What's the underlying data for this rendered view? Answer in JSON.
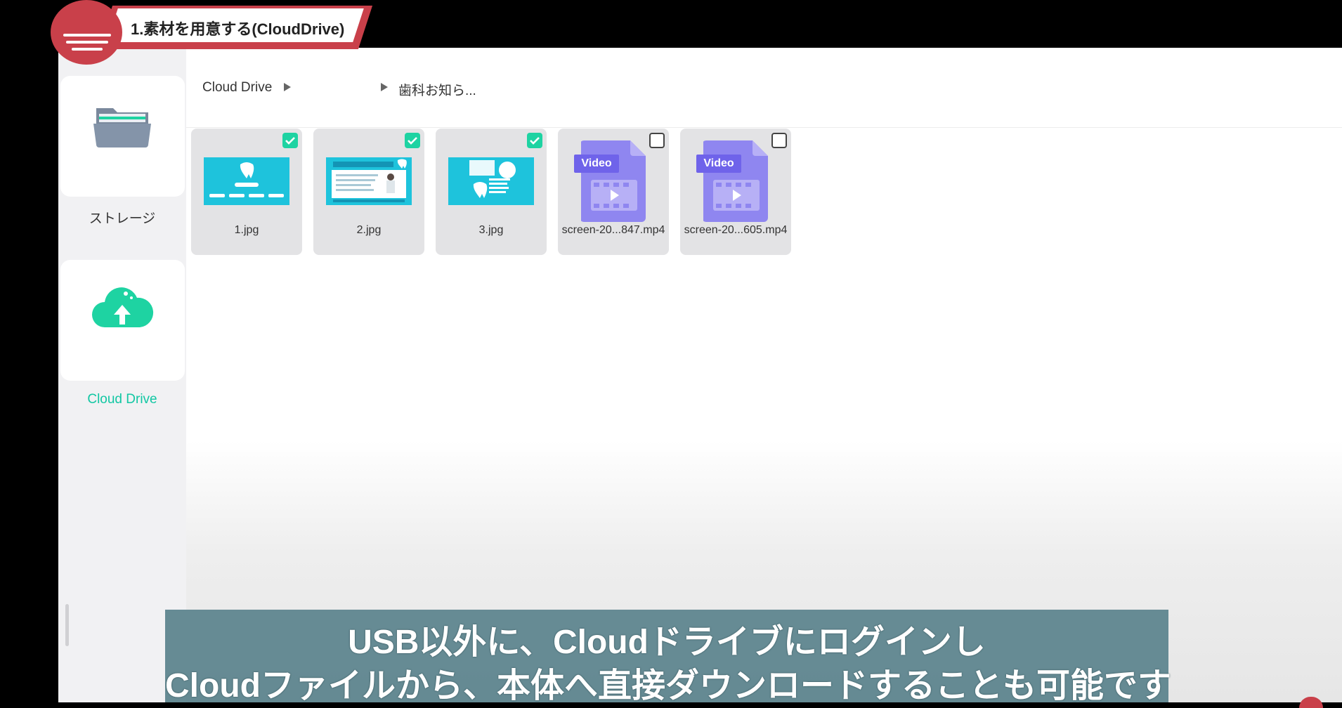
{
  "step_banner": {
    "title": "1.素材を用意する(CloudDrive)"
  },
  "sidebar": {
    "items": [
      {
        "label": "ストレージ",
        "icon": "folder-icon"
      },
      {
        "label": "Cloud Drive",
        "icon": "cloud-upload-icon",
        "active": true
      }
    ]
  },
  "breadcrumb": {
    "root": "Cloud Drive",
    "current": "歯科お知ら..."
  },
  "files": [
    {
      "name": "1.jpg",
      "type": "image",
      "checked": true
    },
    {
      "name": "2.jpg",
      "type": "image",
      "checked": true
    },
    {
      "name": "3.jpg",
      "type": "image",
      "checked": true
    },
    {
      "name": "screen-20...847.mp4",
      "type": "video",
      "badge": "Video",
      "checked": false
    },
    {
      "name": "screen-20...605.mp4",
      "type": "video",
      "badge": "Video",
      "checked": false
    }
  ],
  "subtitle": {
    "line1": "USB以外に、Cloudドライブにログインし",
    "line2": "Cloudファイルから、本体へ直接ダウンロードすることも可能です"
  },
  "colors": {
    "accent": "#1ed3a2",
    "video": "#6f63ea",
    "banner": "#c9404a"
  }
}
